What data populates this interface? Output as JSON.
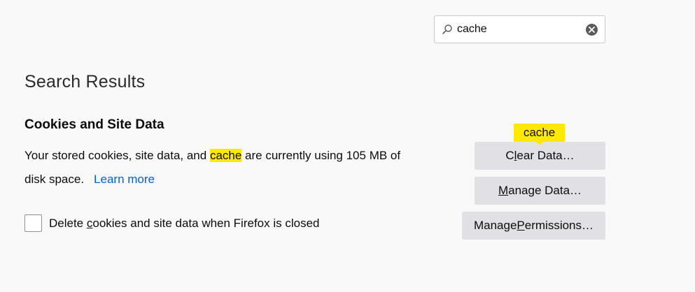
{
  "search": {
    "value": "cache",
    "icon": "search-icon",
    "clear_icon": "clear-icon"
  },
  "results": {
    "title": "Search Results"
  },
  "cookies": {
    "heading": "Cookies and Site Data",
    "desc_before": "Your stored cookies, site data, and ",
    "desc_highlight": "cache",
    "desc_after_line1": " are currently using 105 MB of",
    "desc_line2": "disk space.",
    "learn_more": "Learn more",
    "delete_label_before": "Delete ",
    "delete_label_accesskey": "c",
    "delete_label_after": "ookies and site data when Firefox is closed",
    "delete_checked": false
  },
  "buttons": {
    "clear_pre": "C",
    "clear_key": "l",
    "clear_post": "ear Data…",
    "manage_pre": "",
    "manage_key": "M",
    "manage_post": "anage Data…",
    "perms_pre": "Manage ",
    "perms_key": "P",
    "perms_post": "ermissions…"
  },
  "tooltip": {
    "text": "cache"
  },
  "colors": {
    "highlight": "#ffe900",
    "link": "#0060df",
    "button_bg": "#e1e1e5",
    "page_bg": "#f9f9fa"
  }
}
